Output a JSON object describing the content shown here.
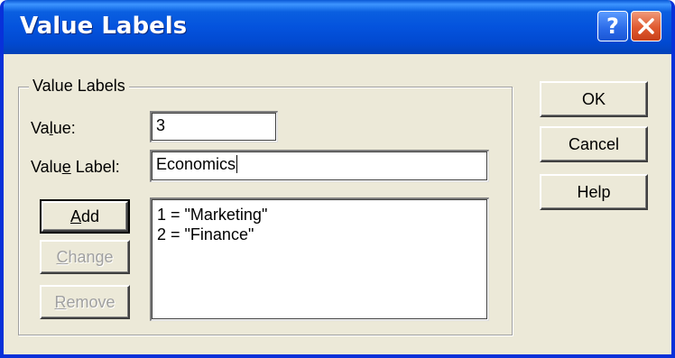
{
  "window": {
    "title": "Value Labels",
    "help_glyph": "?",
    "close_glyph": "✕"
  },
  "group": {
    "legend": "Value Labels",
    "value_label_pre": "Va",
    "value_label_u": "l",
    "value_label_post": "ue:",
    "value_input": "3",
    "value_label2_pre": "Valu",
    "value_label2_u": "e",
    "value_label2_post": " Label:",
    "value_label_input": "Economics"
  },
  "buttons": {
    "add_u": "A",
    "add_rest": "dd",
    "change_u": "C",
    "change_rest": "hange",
    "remove_u": "R",
    "remove_rest": "emove",
    "ok": "OK",
    "cancel": "Cancel",
    "help": "Help"
  },
  "list": {
    "items": [
      "1 = \"Marketing\"",
      "2 = \"Finance\""
    ]
  }
}
